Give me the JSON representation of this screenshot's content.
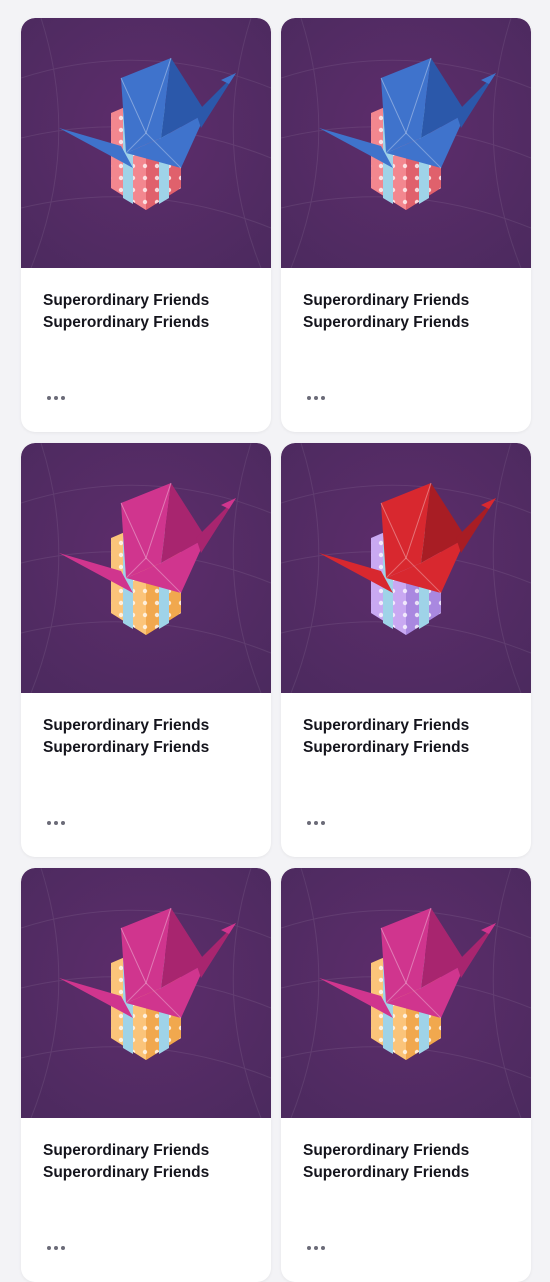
{
  "colors": {
    "thumb_bg_top": "#4b2a5e",
    "thumb_bg_bottom": "#5e2d6c",
    "text": "#14141c",
    "menu_dots": "#6b6b78"
  },
  "cards": [
    {
      "title": "Superordinary Friends",
      "subtitle": "Superordinary Friends",
      "menu_icon": "more-horizontal-icon",
      "art": {
        "crane_color": "#3f73cc",
        "crane_shade": "#2b58aa",
        "gift_color": "#f3878f",
        "gift_shade": "#e0616c",
        "ribbon_color": "#9fd3e8",
        "base_color": "#ef4f64"
      }
    },
    {
      "title": "Superordinary Friends",
      "subtitle": "Superordinary Friends",
      "menu_icon": "more-horizontal-icon",
      "art": {
        "crane_color": "#3f73cc",
        "crane_shade": "#2b58aa",
        "gift_color": "#f3878f",
        "gift_shade": "#e0616c",
        "ribbon_color": "#9fd3e8",
        "base_color": "#ef4f64"
      }
    },
    {
      "title": "Superordinary Friends",
      "subtitle": "Superordinary Friends",
      "menu_icon": "more-horizontal-icon",
      "art": {
        "crane_color": "#d0358e",
        "crane_shade": "#a8256f",
        "gift_color": "#fbc47a",
        "gift_shade": "#f1a84e",
        "ribbon_color": "#9fd3e8",
        "base_color": "#f5a623"
      }
    },
    {
      "title": "Superordinary Friends",
      "subtitle": "Superordinary Friends",
      "menu_icon": "more-horizontal-icon",
      "art": {
        "crane_color": "#d8282f",
        "crane_shade": "#a81d24",
        "gift_color": "#c9a9f2",
        "gift_shade": "#a988e0",
        "ribbon_color": "#9fd3e8",
        "base_color": "#8f74d8"
      }
    },
    {
      "title": "Superordinary Friends",
      "subtitle": "Superordinary Friends",
      "menu_icon": "more-horizontal-icon",
      "art": {
        "crane_color": "#d0358e",
        "crane_shade": "#a8256f",
        "gift_color": "#fbc47a",
        "gift_shade": "#f1a84e",
        "ribbon_color": "#9fd3e8",
        "base_color": "#f5a623"
      }
    },
    {
      "title": "Superordinary Friends",
      "subtitle": "Superordinary Friends",
      "menu_icon": "more-horizontal-icon",
      "art": {
        "crane_color": "#d0358e",
        "crane_shade": "#a8256f",
        "gift_color": "#fbc47a",
        "gift_shade": "#f1a84e",
        "ribbon_color": "#9fd3e8",
        "base_color": "#f5a623"
      }
    }
  ]
}
